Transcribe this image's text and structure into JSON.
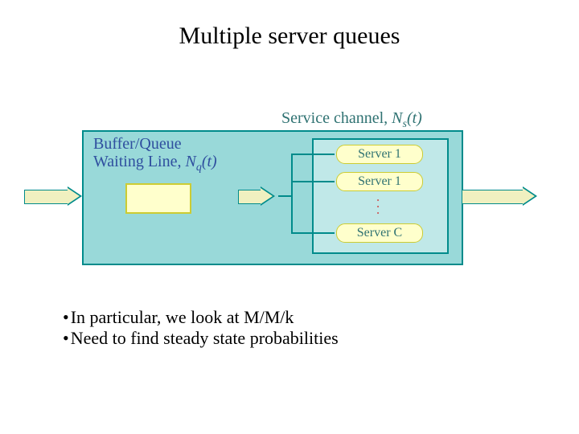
{
  "title": "Multiple server queues",
  "diagram": {
    "service_label_prefix": "Service channel, ",
    "service_label_var": "N",
    "service_label_sub": "s",
    "service_label_arg": "(t)",
    "buffer_line1": "Buffer/Queue",
    "buffer_line2_prefix": "Waiting Line, ",
    "buffer_line2_var": "N",
    "buffer_line2_sub": "q",
    "buffer_line2_arg": "(t)",
    "server1": "Server 1",
    "server2": "Server 1",
    "serverC": "Server C"
  },
  "bullets": {
    "b1": "In particular, we look at M/M/k",
    "b2": "Need to find steady state probabilities"
  }
}
